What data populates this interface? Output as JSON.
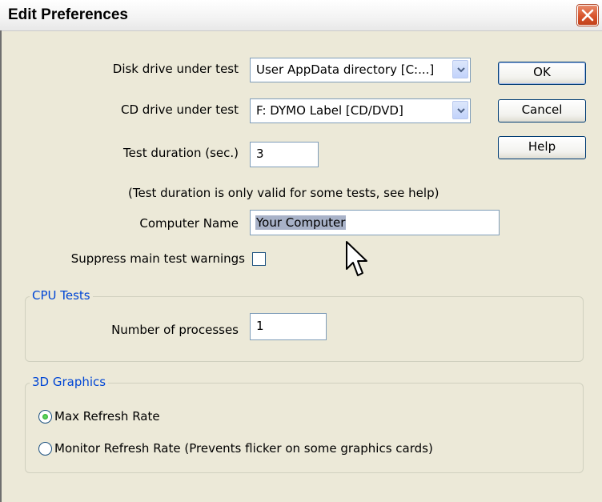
{
  "window": {
    "title": "Edit Preferences"
  },
  "fields": {
    "disk_drive": {
      "label": "Disk drive under test",
      "value": "User AppData directory [C:...]"
    },
    "cd_drive": {
      "label": "CD drive under test",
      "value": "F:  DYMO Label [CD/DVD]"
    },
    "test_duration": {
      "label": "Test duration (sec.)",
      "value": "3"
    },
    "duration_note": "(Test duration is only valid for some tests, see help)",
    "computer_name": {
      "label": "Computer Name",
      "value": "Your Computer"
    },
    "suppress_warnings": {
      "label": "Suppress main test warnings",
      "checked": false
    }
  },
  "buttons": {
    "ok": "OK",
    "cancel": "Cancel",
    "help": "Help"
  },
  "cpu_tests": {
    "title": "CPU Tests",
    "num_processes": {
      "label": "Number of processes",
      "value": "1"
    }
  },
  "graphics_3d": {
    "title": "3D Graphics",
    "options": [
      {
        "label": "Max Refresh Rate",
        "selected": true
      },
      {
        "label": "Monitor Refresh Rate (Prevents flicker on some graphics cards)",
        "selected": false
      }
    ]
  },
  "colors": {
    "group_title": "#0046d5",
    "close_button": "#d8542c",
    "field_border": "#7f9db9"
  },
  "icons": [
    "close-icon",
    "chevron-down-icon",
    "mouse-pointer-icon"
  ]
}
